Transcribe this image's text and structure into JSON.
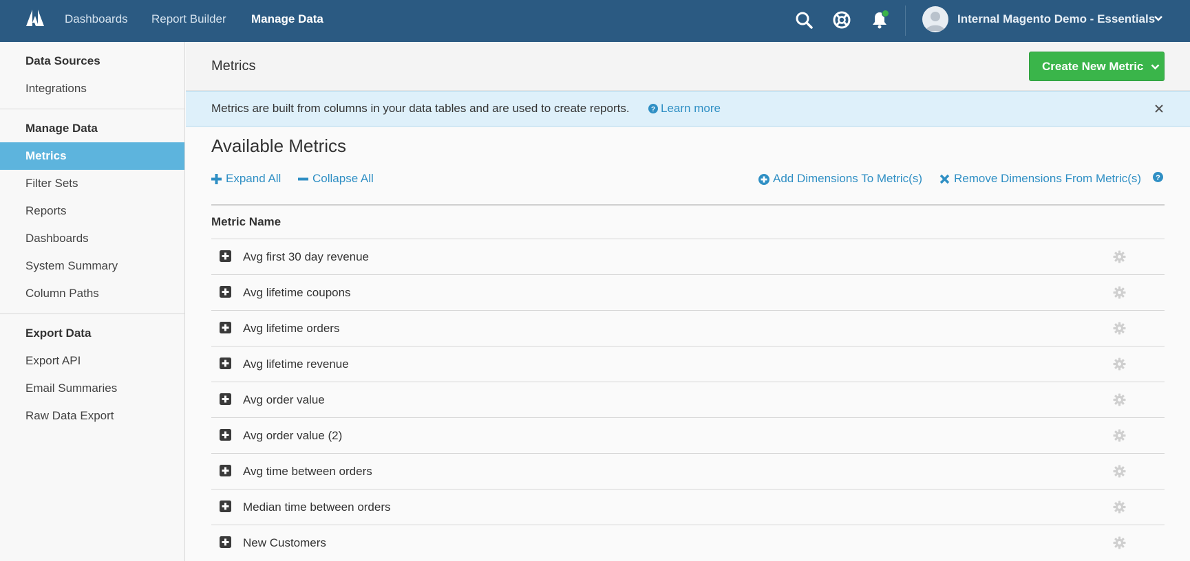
{
  "topnav": {
    "links": [
      {
        "label": "Dashboards"
      },
      {
        "label": "Report Builder"
      },
      {
        "label": "Manage Data"
      }
    ],
    "account_name": "Internal Magento Demo - Essentials"
  },
  "sidebar": {
    "sections": [
      {
        "heading": "Data Sources",
        "items": [
          "Integrations"
        ]
      },
      {
        "heading": "Manage Data",
        "items": [
          "Metrics",
          "Filter Sets",
          "Reports",
          "Dashboards",
          "System Summary",
          "Column Paths"
        ]
      },
      {
        "heading": "Export Data",
        "items": [
          "Export API",
          "Email Summaries",
          "Raw Data Export"
        ]
      }
    ],
    "active_item": "Metrics"
  },
  "page": {
    "title": "Metrics",
    "create_button": "Create New Metric"
  },
  "banner": {
    "text": "Metrics are built from columns in your data tables and are used to create reports.",
    "link": "Learn more"
  },
  "section": {
    "title": "Available Metrics",
    "expand_all": "Expand All",
    "collapse_all": "Collapse All",
    "add_dimensions": "Add Dimensions To Metric(s)",
    "remove_dimensions": "Remove Dimensions From Metric(s)"
  },
  "table": {
    "column_header": "Metric Name",
    "rows": [
      "Avg first 30 day revenue",
      "Avg lifetime coupons",
      "Avg lifetime orders",
      "Avg lifetime revenue",
      "Avg order value",
      "Avg order value (2)",
      "Avg time between orders",
      "Median time between orders",
      "New Customers"
    ]
  },
  "colors": {
    "topbar": "#2b5a82",
    "active_sidebar": "#5db4dd",
    "create_button": "#3ab54a",
    "link": "#2f8fc4",
    "banner_bg": "#def0fa",
    "notification_dot": "#3cb34a"
  },
  "icons": [
    "adobe-logo-icon",
    "search-icon",
    "help-lifebuoy-icon",
    "bell-icon",
    "avatar-icon",
    "chevron-down-icon",
    "question-circle-icon",
    "close-icon",
    "plus-icon",
    "minus-icon",
    "plus-circle-icon",
    "x-icon",
    "expand-plus-square-icon",
    "gear-icon"
  ]
}
